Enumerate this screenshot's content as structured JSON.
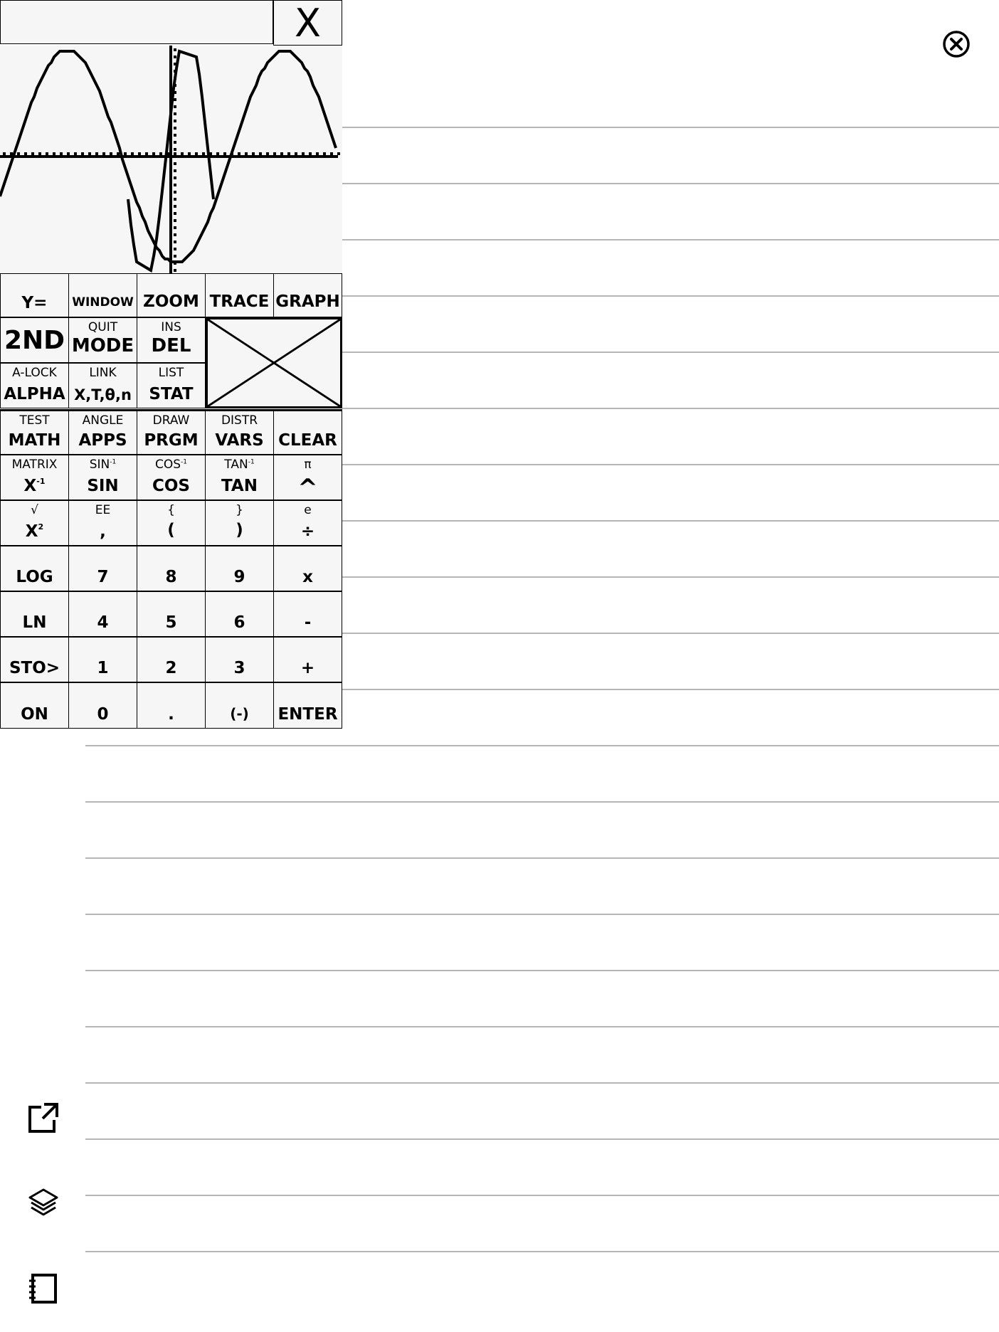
{
  "window": {
    "close_label": "X"
  },
  "calculator": {
    "entry_value": "",
    "keys": {
      "y_eq": {
        "main": "Y="
      },
      "window": {
        "main": "WINDOW"
      },
      "zoom": {
        "main": "ZOOM"
      },
      "trace": {
        "main": "TRACE"
      },
      "graph": {
        "main": "GRAPH"
      },
      "second": {
        "main": "2ND"
      },
      "mode": {
        "sec": "QUIT",
        "main": "MODE"
      },
      "del": {
        "sec": "INS",
        "main": "DEL"
      },
      "alpha": {
        "sec": "A-LOCK",
        "main": "ALPHA"
      },
      "xt": {
        "sec": "LINK",
        "main": "X,T,θ,n"
      },
      "stat": {
        "sec": "LIST",
        "main": "STAT"
      },
      "math": {
        "sec": "TEST",
        "main": "MATH"
      },
      "apps": {
        "sec": "ANGLE",
        "main": "APPS"
      },
      "prgm": {
        "sec": "DRAW",
        "main": "PRGM"
      },
      "vars": {
        "sec": "DISTR",
        "main": "VARS"
      },
      "clear": {
        "main": "CLEAR"
      },
      "inv": {
        "sec": "MATRIX",
        "main": "X",
        "sup": "-1"
      },
      "sin": {
        "sec": "SIN",
        "sec_sup": "-1",
        "main": "SIN"
      },
      "cos": {
        "sec": "COS",
        "sec_sup": "-1",
        "main": "COS"
      },
      "tan": {
        "sec": "TAN",
        "sec_sup": "-1",
        "main": "TAN"
      },
      "pow": {
        "sec": "π",
        "main": "^"
      },
      "sq": {
        "sec": "√",
        "main": "X",
        "sup": "2"
      },
      "comma": {
        "sec": "EE",
        "main": ","
      },
      "lparen": {
        "sec": "{",
        "main": "("
      },
      "rparen": {
        "sec": "}",
        "main": ")"
      },
      "div": {
        "sec": "e",
        "main": "÷"
      },
      "log": {
        "main": "LOG"
      },
      "n7": {
        "main": "7"
      },
      "n8": {
        "main": "8"
      },
      "n9": {
        "main": "9"
      },
      "mul": {
        "main": "x"
      },
      "ln": {
        "main": "LN"
      },
      "n4": {
        "main": "4"
      },
      "n5": {
        "main": "5"
      },
      "n6": {
        "main": "6"
      },
      "sub": {
        "main": "-"
      },
      "sto": {
        "main": "STO>"
      },
      "n1": {
        "main": "1"
      },
      "n2": {
        "main": "2"
      },
      "n3": {
        "main": "3"
      },
      "add": {
        "main": "+"
      },
      "on": {
        "main": "ON"
      },
      "n0": {
        "main": "0"
      },
      "dot": {
        "main": "."
      },
      "neg": {
        "main": "(-)"
      },
      "enter": {
        "main": "ENTER"
      }
    }
  },
  "icons": {
    "close": "close-circle-icon",
    "open_external": "open-external-icon",
    "layers": "layers-icon",
    "notebook": "notebook-icon"
  }
}
